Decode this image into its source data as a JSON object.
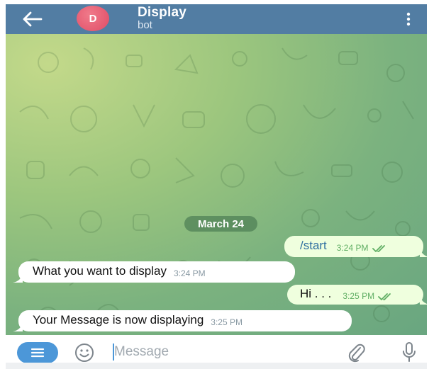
{
  "header": {
    "avatar_letter": "D",
    "title": "Display",
    "subtitle": "bot",
    "back_icon": "arrow-left-icon",
    "menu_icon": "vertical-dots-icon"
  },
  "chat": {
    "date_separator": "March 24",
    "messages": [
      {
        "direction": "outgoing",
        "text": "/start",
        "time": "3:24 PM",
        "status": "read"
      },
      {
        "direction": "incoming",
        "text": "What you want to display",
        "time": "3:24 PM"
      },
      {
        "direction": "outgoing",
        "text": "Hi . . .",
        "time": "3:25 PM",
        "status": "read"
      },
      {
        "direction": "incoming",
        "text": "Your Message is now displaying",
        "time": "3:25 PM"
      }
    ]
  },
  "input": {
    "placeholder": "Message",
    "menu_icon": "hamburger-icon",
    "emoji_icon": "smiley-icon",
    "attach_icon": "paperclip-icon",
    "mic_icon": "microphone-icon"
  },
  "colors": {
    "header": "#527da3",
    "outgoing_bubble": "#efffde",
    "incoming_bubble": "#ffffff",
    "accent": "#4c97d8",
    "read_ticks": "#5fae63"
  }
}
